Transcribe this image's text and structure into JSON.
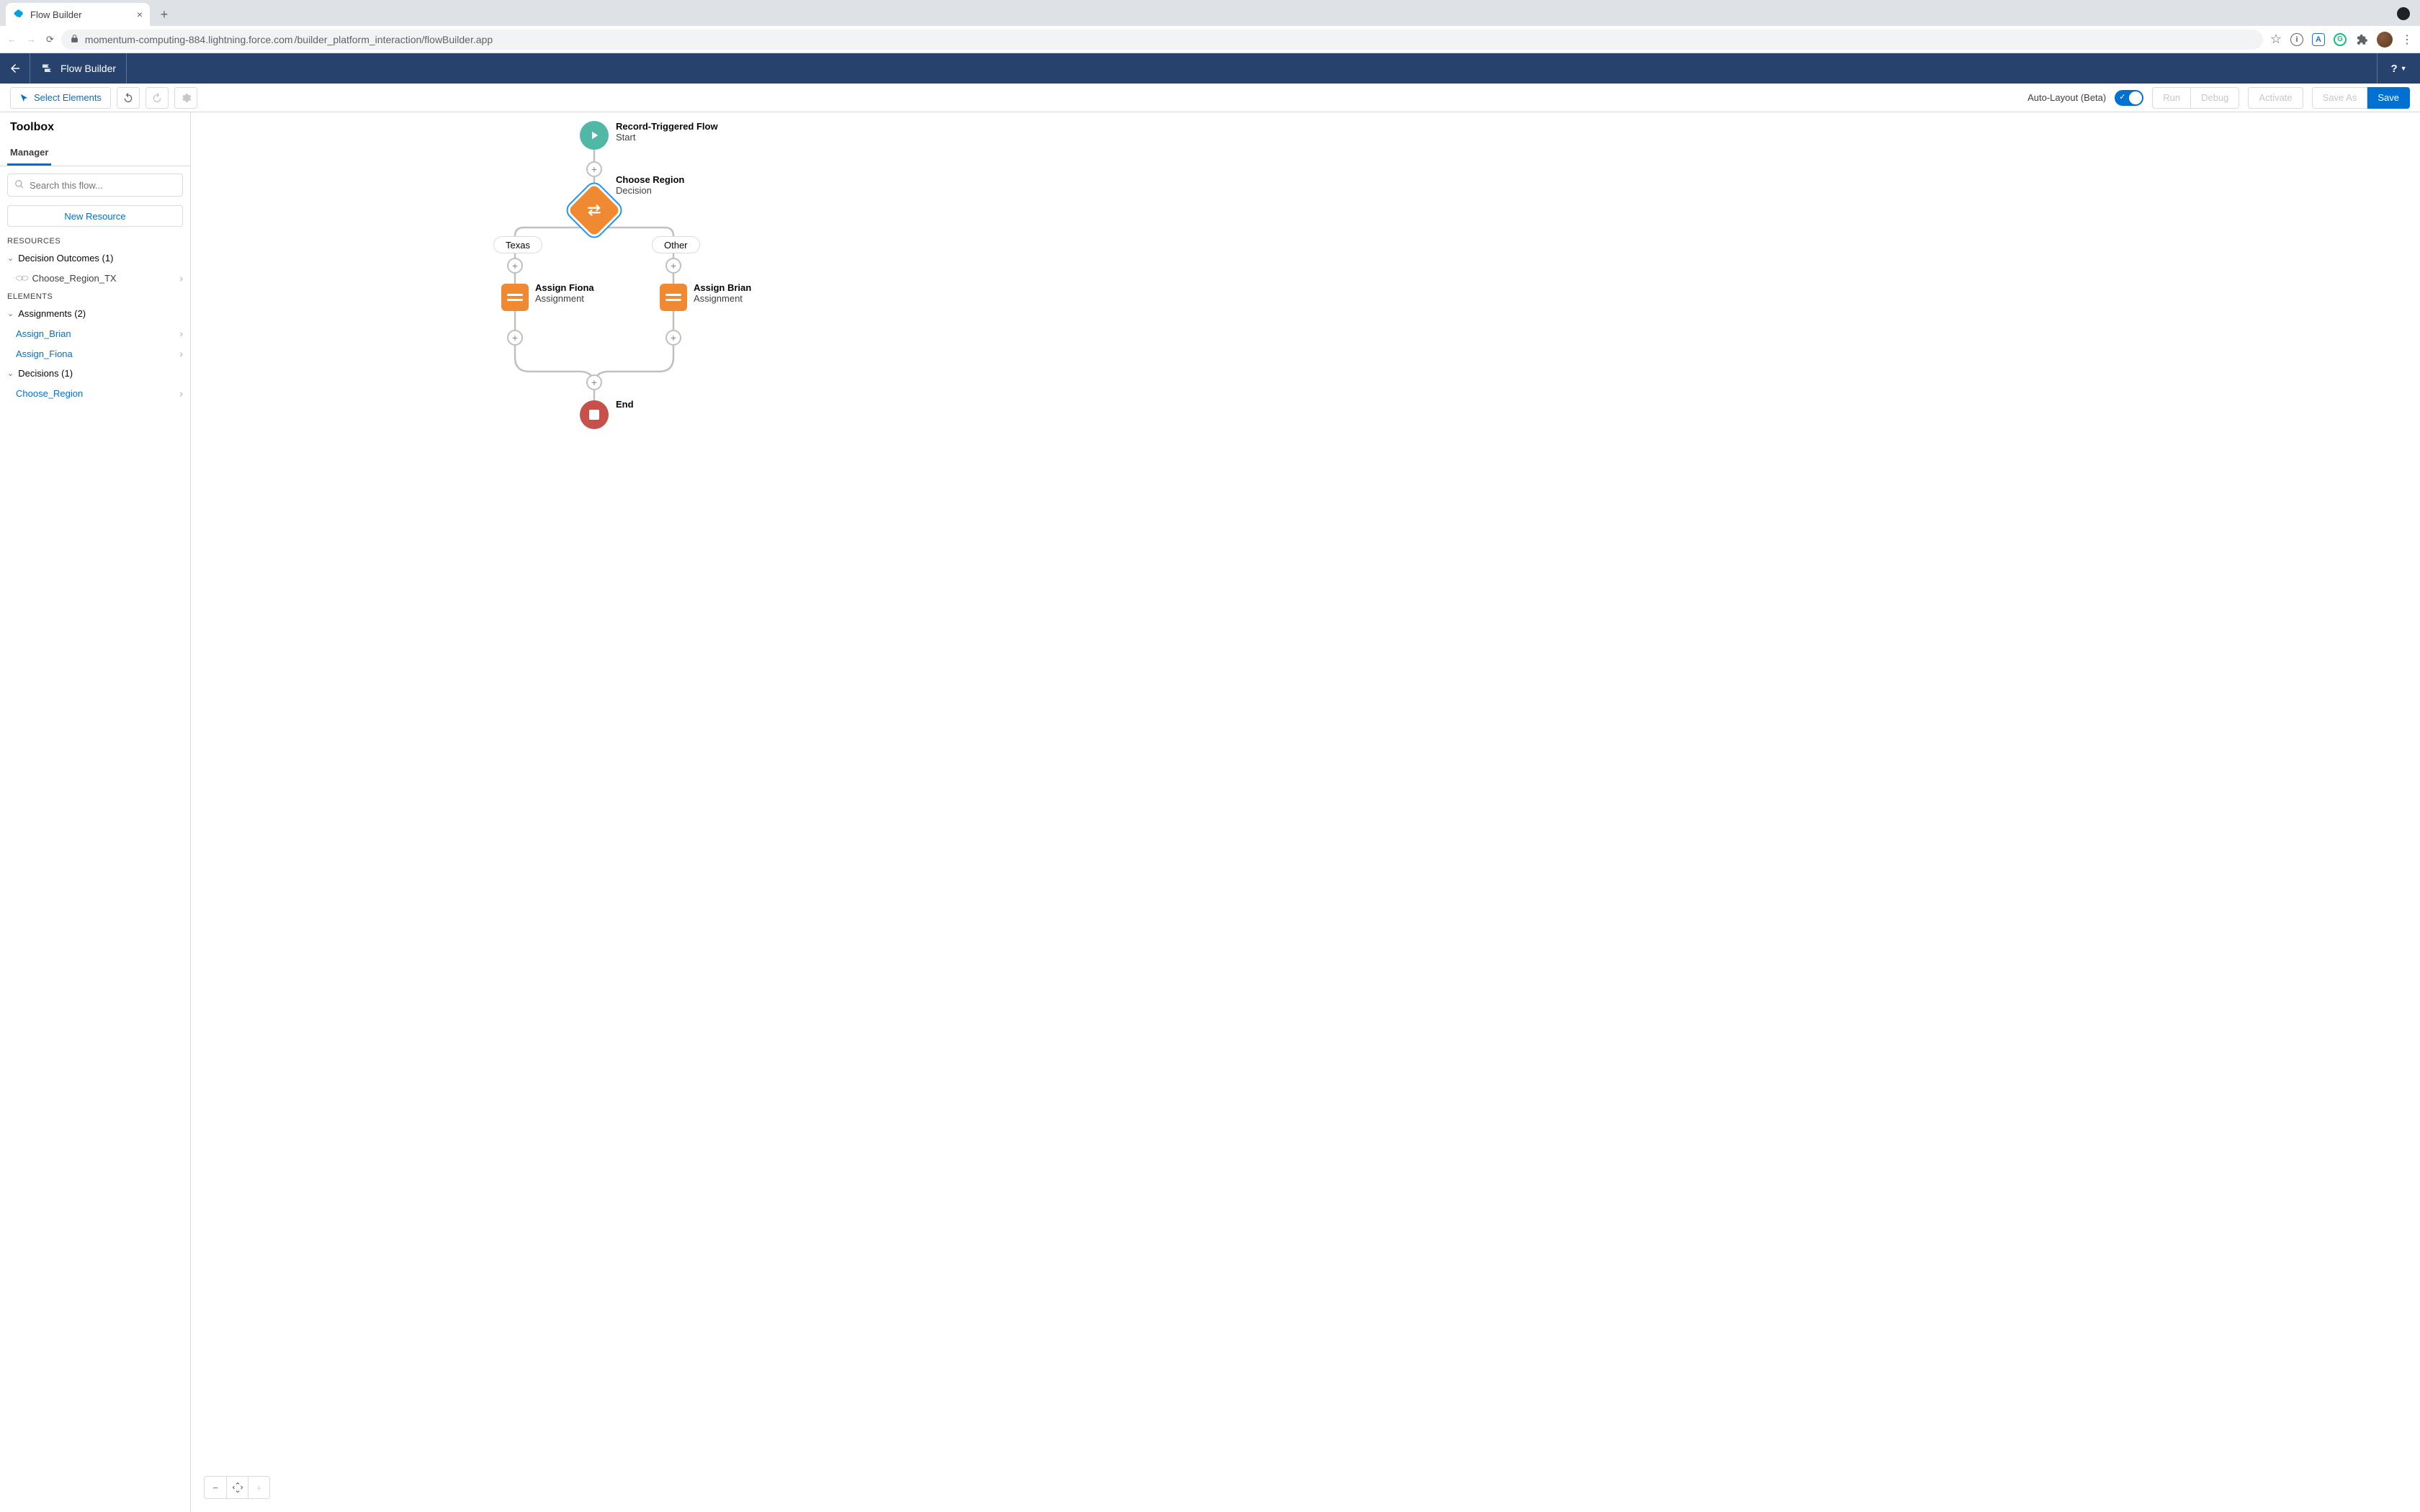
{
  "browser": {
    "tab_title": "Flow Builder",
    "url_domain": "momentum-computing-884.lightning.force.com",
    "url_path": "/builder_platform_interaction/flowBuilder.app"
  },
  "header": {
    "app_name": "Flow Builder",
    "help_label": "?"
  },
  "toolbar": {
    "select_elements": "Select Elements",
    "auto_layout_label": "Auto-Layout (Beta)",
    "run": "Run",
    "debug": "Debug",
    "activate": "Activate",
    "save_as": "Save As",
    "save": "Save"
  },
  "sidebar": {
    "title": "Toolbox",
    "tab": "Manager",
    "search_placeholder": "Search this flow...",
    "new_resource": "New Resource",
    "sections": {
      "resources": "RESOURCES",
      "elements": "ELEMENTS"
    },
    "groups": {
      "decision_outcomes": "Decision Outcomes (1)",
      "assignments": "Assignments (2)",
      "decisions": "Decisions (1)"
    },
    "items": {
      "choose_region_tx": "Choose_Region_TX",
      "assign_brian": "Assign_Brian",
      "assign_fiona": "Assign_Fiona",
      "choose_region": "Choose_Region"
    }
  },
  "flow": {
    "start": {
      "title": "Record-Triggered Flow",
      "sub": "Start"
    },
    "decision": {
      "title": "Choose Region",
      "sub": "Decision"
    },
    "branch_left": "Texas",
    "branch_right": "Other",
    "assign_left": {
      "title": "Assign Fiona",
      "sub": "Assignment"
    },
    "assign_right": {
      "title": "Assign Brian",
      "sub": "Assignment"
    },
    "end": {
      "title": "End"
    }
  }
}
